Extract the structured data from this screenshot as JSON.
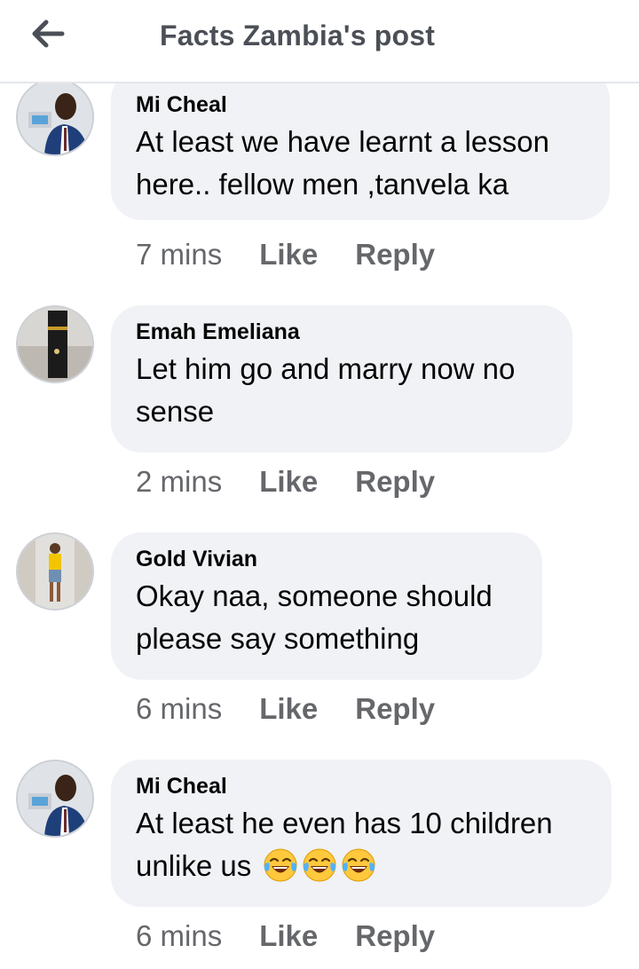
{
  "header": {
    "back_icon": "arrow-left-icon",
    "title": "Facts Zambia's post"
  },
  "comments": [
    {
      "author": "Mi Cheal",
      "text_lines": [
        "At least we have learnt a lesson",
        "here.. fellow men ,tanvela ka"
      ],
      "time": "7 mins",
      "like_label": "Like",
      "reply_label": "Reply",
      "emojis": []
    },
    {
      "author": "Emah Emeliana",
      "text_lines": [
        "Let him go and marry now no",
        "sense"
      ],
      "time": "2 mins",
      "like_label": "Like",
      "reply_label": "Reply",
      "emojis": []
    },
    {
      "author": "Gold Vivian",
      "text_lines": [
        "Okay naa, someone should",
        "please say something"
      ],
      "time": "6 mins",
      "like_label": "Like",
      "reply_label": "Reply",
      "emojis": []
    },
    {
      "author": "Mi Cheal",
      "text_lines": [
        "At least he even has 10 children",
        "unlike us"
      ],
      "time": "6 mins",
      "like_label": "Like",
      "reply_label": "Reply",
      "emojis": [
        "tears-of-joy-emoji",
        "tears-of-joy-emoji",
        "tears-of-joy-emoji"
      ]
    }
  ],
  "colors": {
    "bubble": "#f0f2f5",
    "muted_text": "#65676b",
    "title_text": "#4b4f56"
  }
}
